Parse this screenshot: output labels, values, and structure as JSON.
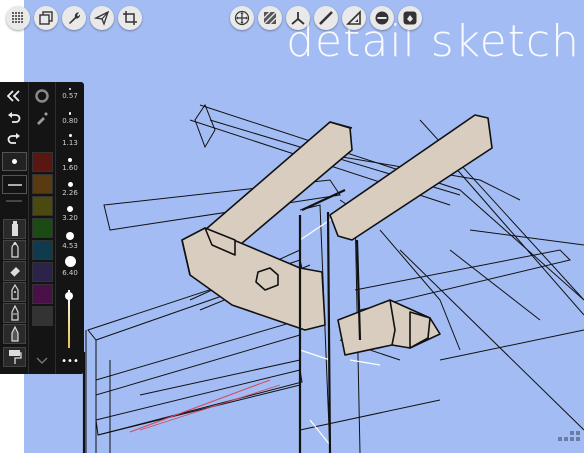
{
  "title": "detail sketch",
  "colors": {
    "canvas": "#a3bdf4",
    "beam": "#d8cdbf",
    "palette_bg": "#141414"
  },
  "top_left_buttons": [
    {
      "name": "grid-menu",
      "icon": "grid-icon"
    },
    {
      "name": "layers",
      "icon": "layers-icon"
    },
    {
      "name": "tools-settings",
      "icon": "wrench-icon"
    },
    {
      "name": "share",
      "icon": "airplane-icon"
    },
    {
      "name": "crop",
      "icon": "crop-icon"
    }
  ],
  "top_center_buttons": [
    {
      "name": "transform",
      "icon": "move-icon"
    },
    {
      "name": "hatch",
      "icon": "hatch-icon"
    },
    {
      "name": "perspective",
      "icon": "perspective-icon"
    },
    {
      "name": "ruler",
      "icon": "ruler-icon"
    },
    {
      "name": "triangle",
      "icon": "triangle-ruler-icon"
    },
    {
      "name": "ellipse",
      "icon": "ellipse-icon"
    },
    {
      "name": "fill",
      "icon": "fill-icon"
    }
  ],
  "brush_sizes": [
    "0.57",
    "0.80",
    "1.13",
    "1.60",
    "2.26",
    "3.20",
    "4.53",
    "6.40"
  ],
  "swatches": [
    "#5a1712",
    "#5a3a10",
    "#4a4a10",
    "#1b4a14",
    "#0e3b4e",
    "#2c234a",
    "#4a1048",
    "#333333"
  ],
  "tools": [
    "marker",
    "pencil",
    "eraser",
    "pen",
    "fineliner",
    "brush",
    "roller"
  ],
  "more_label": "•••"
}
